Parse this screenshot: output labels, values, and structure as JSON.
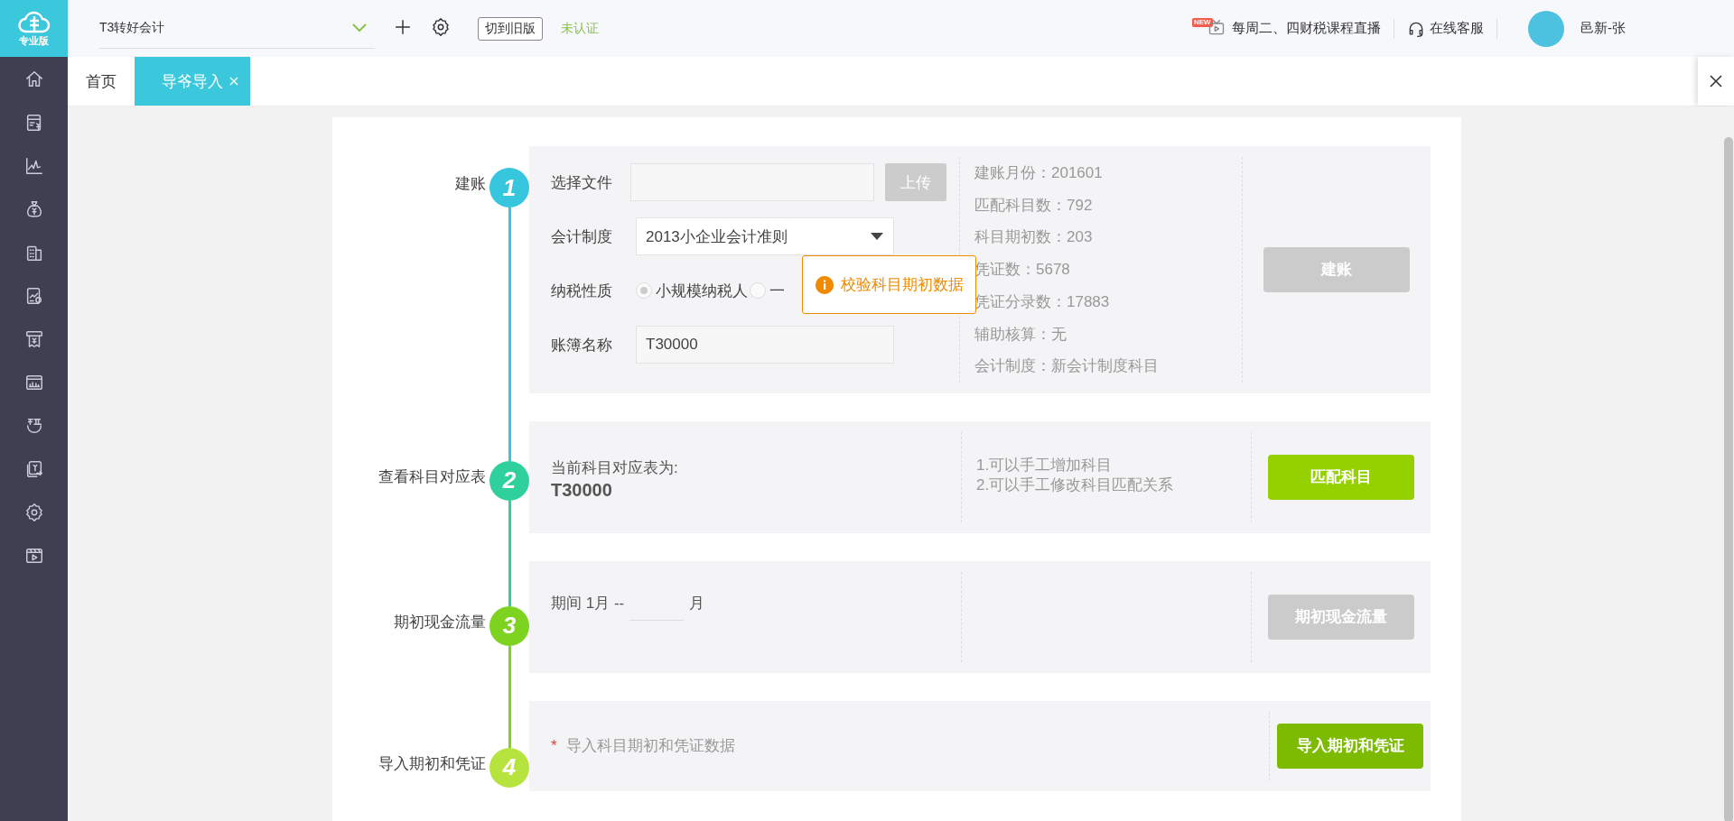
{
  "sidebar": {
    "edition": "专业版"
  },
  "topbar": {
    "account": "T3转好会计",
    "old_version_button": "切到旧版",
    "auth_status": "未认证",
    "new_badge": "NEW",
    "live_course": "每周二、四财税课程直播",
    "support": "在线客服",
    "user": "邑新-张"
  },
  "tabs": [
    {
      "label": "首页",
      "selected": false,
      "closable": false
    },
    {
      "label": "导爷导入",
      "selected": true,
      "closable": true
    }
  ],
  "steps": [
    {
      "kind": "setup",
      "label": "建账",
      "number": "1",
      "file_label": "选择文件",
      "upload_button": "上传",
      "system_label": "会计制度",
      "system_value": "2013小企业会计准则",
      "tax_label": "纳税性质",
      "tax_options": [
        {
          "label": "小规模纳税人",
          "selected": true
        },
        {
          "label": "一",
          "selected": false
        }
      ],
      "name_label": "账簿名称",
      "name_value": "T30000",
      "info": [
        "建账月份：201601",
        "匹配科目数：792",
        "科目期初数：203",
        "凭证数：5678",
        "凭证分录数：17883",
        "辅助核算：无",
        "会计制度：新会计制度科目"
      ],
      "button": {
        "label": "建账",
        "disabled": true
      },
      "tooltip": "校验科目期初数据"
    },
    {
      "kind": "mapping",
      "label": "查看科目对应表",
      "number": "2",
      "title": "当前科目对应表为:",
      "value": "T30000",
      "notes": [
        "1.可以手工增加科目",
        "2.可以手工修改科目匹配关系"
      ],
      "button": {
        "label": "匹配科目",
        "disabled": false
      }
    },
    {
      "kind": "cashflow",
      "label": "期初现金流量",
      "number": "3",
      "period_prefix": "期间 1月 --",
      "period_suffix": "月",
      "button": {
        "label": "期初现金流量",
        "disabled": true
      }
    },
    {
      "kind": "import",
      "label": "导入期初和凭证",
      "number": "4",
      "required_mark": "*",
      "hint": "导入科目期初和凭证数据",
      "button": {
        "label": "导入期初和凭证",
        "disabled": false
      }
    }
  ]
}
